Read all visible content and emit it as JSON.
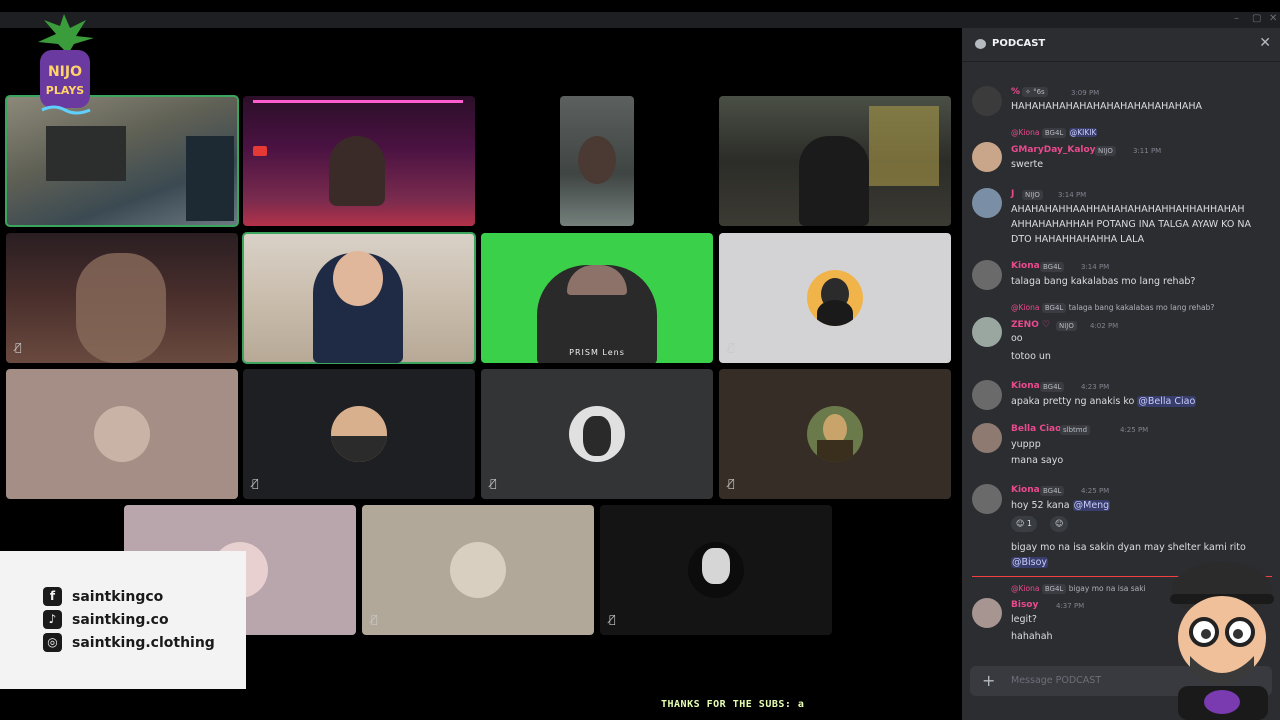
{
  "window": {
    "controls": [
      "–",
      "▢",
      "✕"
    ]
  },
  "chat": {
    "channel_name": "PODCAST",
    "input_placeholder": "Message PODCAST",
    "messages": [
      {
        "author": "%",
        "badge": "✧ °6s",
        "time": "3:09 PM",
        "text": "HAHAHAHAHAHAHAHAHAHAHAHAHAHA",
        "name_color": "#ea4a8e"
      },
      {
        "reply_to": "@Kiona",
        "reply_badge": "BG4L",
        "reply_text": "@KIKIK",
        "author": "GMaryDay_Kaloy",
        "badge": "NIJO",
        "time": "3:11 PM",
        "text": "swerte",
        "name_color": "#ea4a8e"
      },
      {
        "author": "J",
        "badge": "NIJO",
        "time": "3:14 PM",
        "text": "AHAHAHAHHAAHHAHAHAHAHAHHAHHAHHAHAH AHHAHAHAHHAH POTANG INA TALGA AYAW KO NA DTO HAHAHHAHAHHA LALA",
        "name_color": "#ea4a8e"
      },
      {
        "author": "Kiona",
        "badge": "BG4L",
        "time": "3:14 PM",
        "text": "talaga bang kakalabas mo lang rehab?",
        "name_color": "#ea4a8e"
      },
      {
        "reply_to": "@Kiona",
        "reply_badge": "BG4L",
        "reply_text": "talaga bang kakalabas mo lang rehab?",
        "author": "ZENO ♡",
        "badge": "NIJO",
        "time": "4:02 PM",
        "text": "oo",
        "text2": "totoo un",
        "name_color": "#ea4a8e"
      },
      {
        "author": "Kiona",
        "badge": "BG4L",
        "time": "4:23 PM",
        "text": "apaka pretty ng anakis ko",
        "mention": "@Bella Ciao",
        "name_color": "#ea4a8e"
      },
      {
        "author": "Bella Ciao",
        "badge": "slbtmd",
        "time": "4:25 PM",
        "text": "yuppp",
        "text2": "mana sayo",
        "name_color": "#ea4a8e"
      },
      {
        "author": "Kiona",
        "badge": "BG4L",
        "time": "4:25 PM",
        "text": "hoy 52 kana",
        "mention": "@Meng",
        "reaction_count": "1",
        "text2": "bigay mo na isa sakin dyan may shelter kami rito",
        "mention2": "@Bisoy",
        "name_color": "#ea4a8e"
      },
      {
        "reply_to": "@Kiona",
        "reply_badge": "BG4L",
        "reply_text": "bigay mo na isa saki",
        "author": "Bisoy",
        "time": "4:37 PM",
        "text": "legit?",
        "text2": "hahahah",
        "name_color": "#ea4a8e"
      }
    ]
  },
  "video_tiles": [
    {
      "caption": ""
    },
    {
      "caption": ""
    },
    {
      "caption": ""
    },
    {
      "caption": ""
    },
    {
      "caption": ""
    },
    {
      "caption": ""
    },
    {
      "caption": "PRISM Lens"
    },
    {
      "caption": ""
    }
  ],
  "social": {
    "facebook": "saintkingco",
    "tiktok": "saintking.co",
    "instagram": "saintking.clothing"
  },
  "ticker": "THANKS FOR THE SUBS: a",
  "colors": {
    "accent": "#3ba55d",
    "mention": "#c9cdfb",
    "name": "#ea4a8e",
    "new_divider": "#f23f42"
  }
}
